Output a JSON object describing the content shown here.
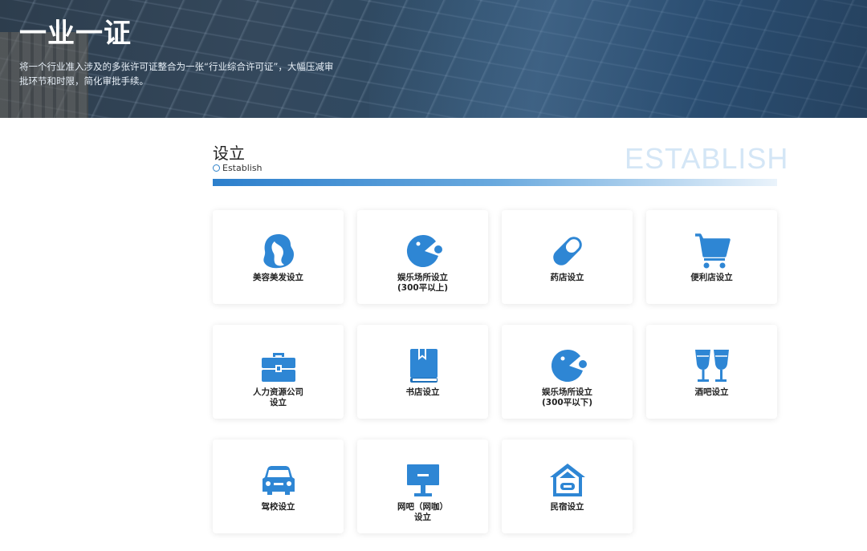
{
  "hero": {
    "title": "一业一证",
    "description": "将一个行业准入涉及的多张许可证整合为一张“行业综合许可证”，大幅压减审批环节和时限，简化审批手续。"
  },
  "section": {
    "title": "设立",
    "subtitle": "Establish",
    "watermark": "ESTABLISH"
  },
  "cards": [
    {
      "label": "美容美发设立",
      "icon": "beauty-salon-icon"
    },
    {
      "label": "娱乐场所设立\n(300平以上)",
      "icon": "pacman-icon"
    },
    {
      "label": "药店设立",
      "icon": "pill-icon"
    },
    {
      "label": "便利店设立",
      "icon": "shopping-cart-icon"
    },
    {
      "label": "人力资源公司\n设立",
      "icon": "briefcase-icon"
    },
    {
      "label": "书店设立",
      "icon": "book-icon"
    },
    {
      "label": "娱乐场所设立\n(300平以下)",
      "icon": "pacman-icon"
    },
    {
      "label": "酒吧设立",
      "icon": "wine-glasses-icon"
    },
    {
      "label": "驾校设立",
      "icon": "car-icon"
    },
    {
      "label": "网吧（网咖）\n设立",
      "icon": "monitor-icon"
    },
    {
      "label": "民宿设立",
      "icon": "house-icon"
    }
  ],
  "colors": {
    "accent": "#2f82c9",
    "icon": "#2e86d4"
  }
}
